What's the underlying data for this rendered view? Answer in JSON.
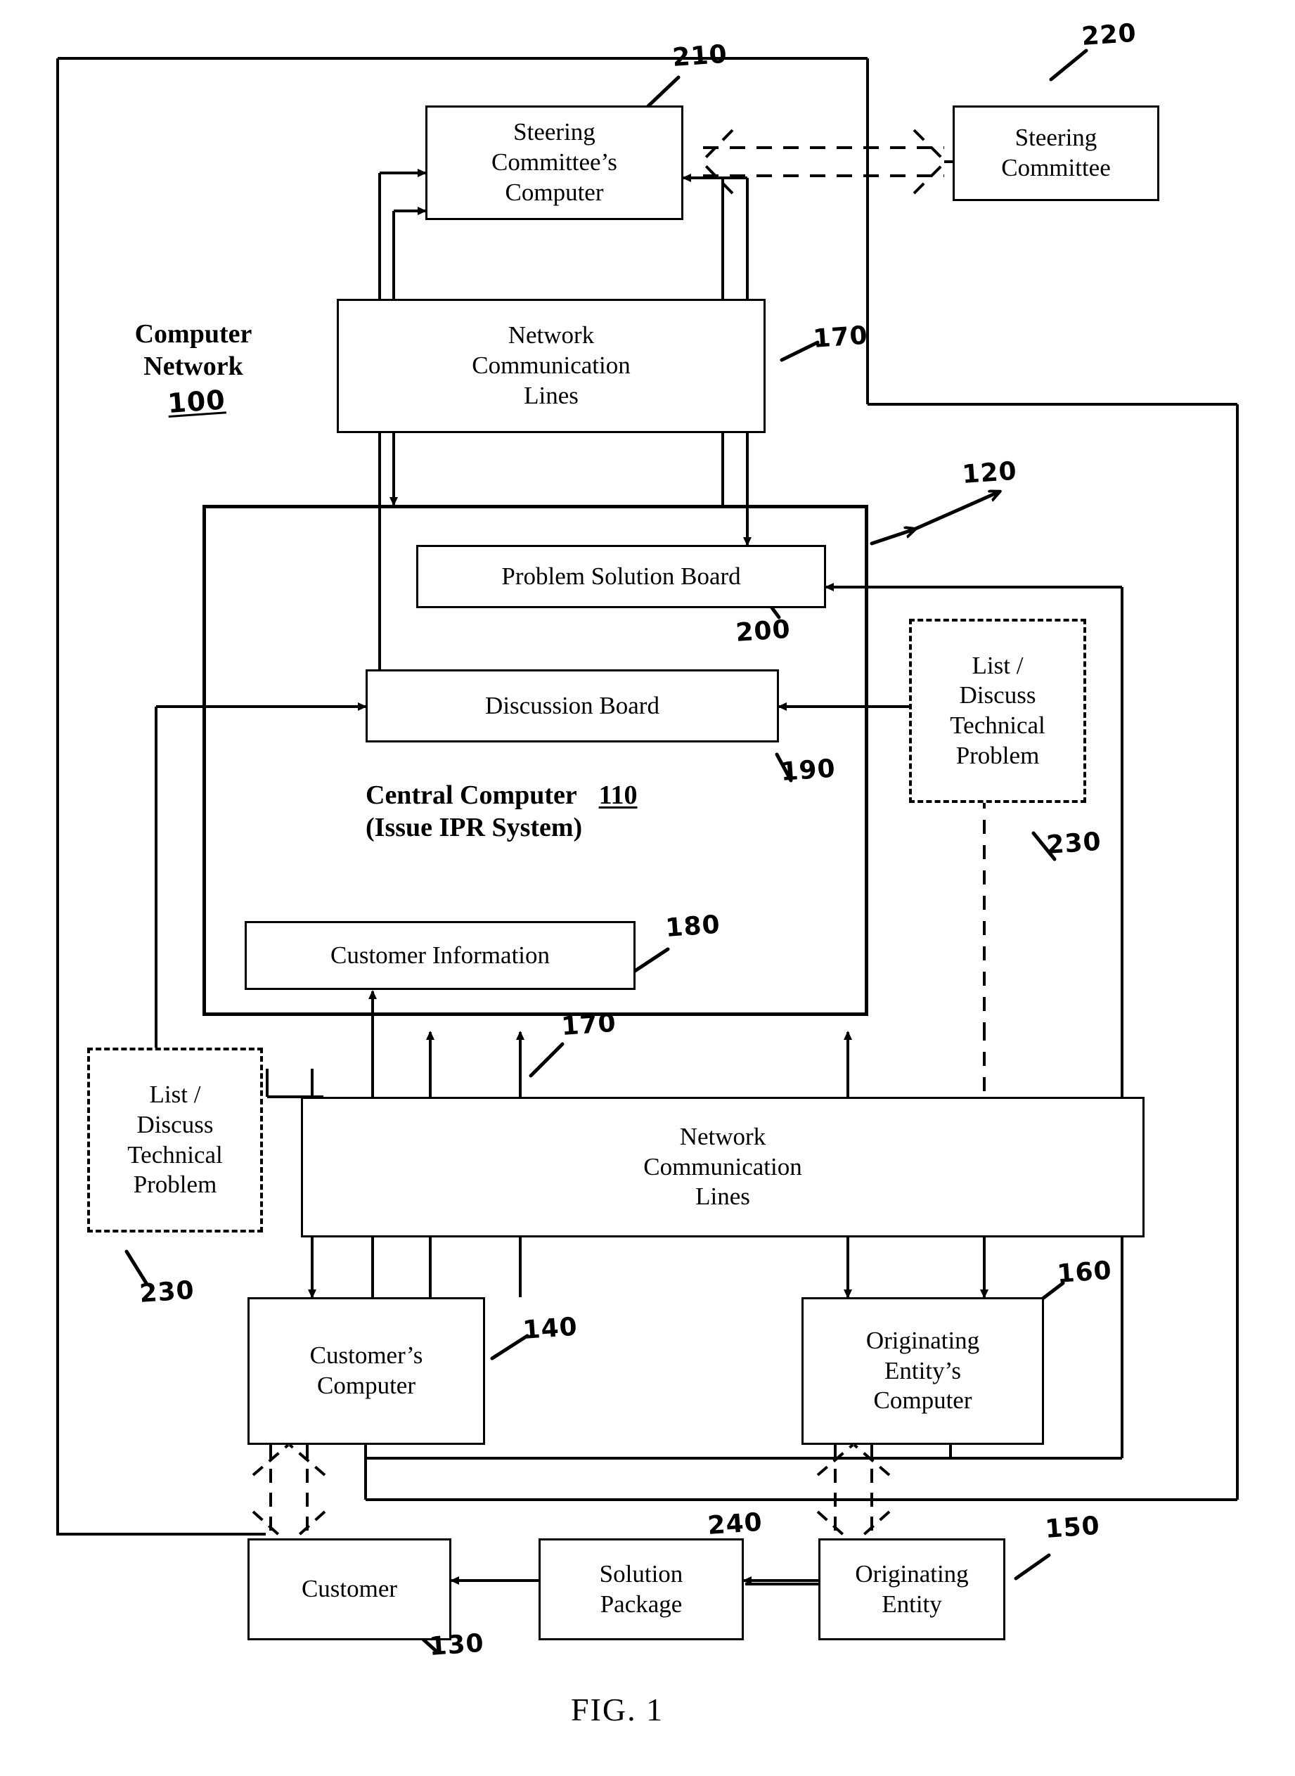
{
  "figure": {
    "caption": "FIG. 1"
  },
  "labels": {
    "computer_network": {
      "line1": "Computer",
      "line2": "Network",
      "ref": "100"
    },
    "central_computer": {
      "line1": "Central Computer",
      "ref": "110",
      "line2": "(Issue IPR System)"
    }
  },
  "nodes": {
    "steering_committees_computer": {
      "lines": [
        "Steering",
        "Committee’s",
        "Computer"
      ],
      "ref": "210"
    },
    "steering_committee": {
      "lines": [
        "Steering",
        "Committee"
      ],
      "ref": "220"
    },
    "network_lines_top": {
      "lines": [
        "Network",
        "Communication",
        "Lines"
      ],
      "ref": "170"
    },
    "network_lines_bottom": {
      "lines": [
        "Network",
        "Communication",
        "Lines"
      ],
      "ref": "170"
    },
    "problem_solution_board": {
      "lines": [
        "Problem Solution Board"
      ],
      "ref": "200"
    },
    "discussion_board": {
      "lines": [
        "Discussion Board"
      ],
      "ref": "190"
    },
    "customer_information": {
      "lines": [
        "Customer Information"
      ],
      "ref": "180"
    },
    "list_discuss_right": {
      "lines": [
        "List /",
        "Discuss",
        "Technical",
        "Problem"
      ],
      "ref": "230"
    },
    "list_discuss_left": {
      "lines": [
        "List /",
        "Discuss",
        "Technical",
        "Problem"
      ],
      "ref": "230"
    },
    "customers_computer": {
      "lines": [
        "Customer’s",
        "Computer"
      ],
      "ref": "140"
    },
    "originating_entitys_computer": {
      "lines": [
        "Originating",
        "Entity’s",
        "Computer"
      ],
      "ref": "160"
    },
    "customer": {
      "lines": [
        "Customer"
      ],
      "ref": "130"
    },
    "solution_package": {
      "lines": [
        "Solution",
        "Package"
      ],
      "ref": "240"
    },
    "originating_entity": {
      "lines": [
        "Originating",
        "Entity"
      ],
      "ref": "150"
    },
    "central_computer_box": {
      "ref": "120"
    }
  },
  "colors": {
    "ink": "#000000",
    "paper": "#ffffff"
  }
}
